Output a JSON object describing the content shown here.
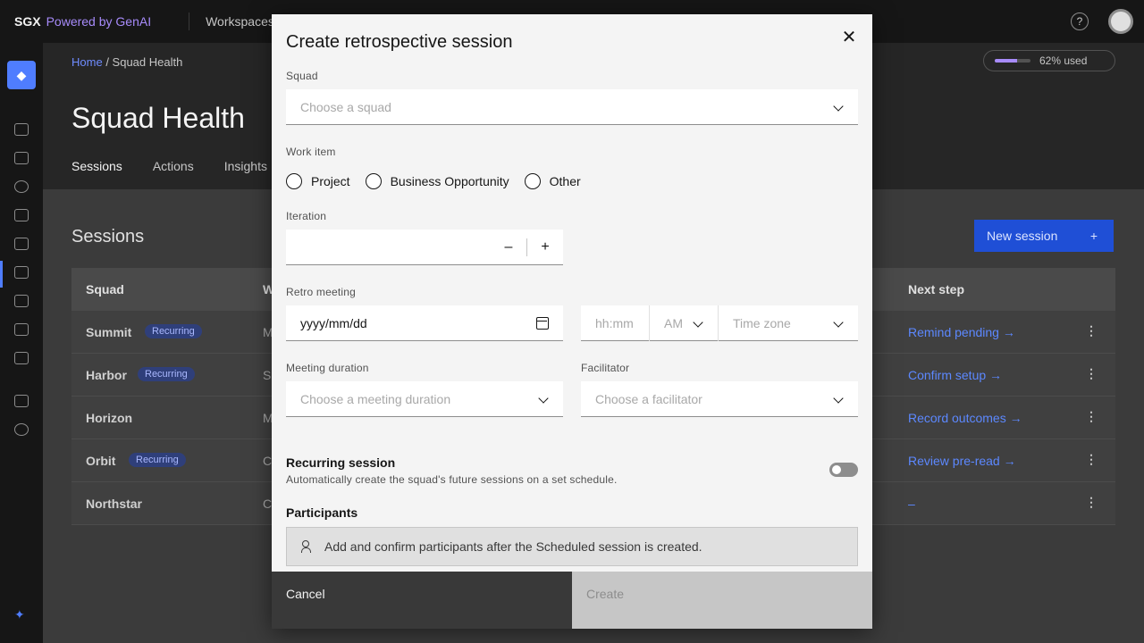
{
  "topbar": {
    "brand": "SGX",
    "brand_sub": "Powered by GenAI",
    "nav": "Workspaces"
  },
  "header": {
    "breadcrumb_home": "Home",
    "breadcrumb_current": "Squad Health",
    "usage_label": "62% used",
    "usage_fraction": 0.62,
    "title": "Squad Health",
    "tabs": [
      "Sessions",
      "Actions",
      "Insights"
    ]
  },
  "main": {
    "section_title": "Sessions",
    "new_button": "New session",
    "table": {
      "headers": [
        "Squad",
        "W",
        "Next step"
      ],
      "rows": [
        {
          "squad": "Summit",
          "tag": "Recurring",
          "mid": "M",
          "next": "Remind pending →"
        },
        {
          "squad": "Harbor",
          "tag": "Recurring",
          "mid": "S",
          "next": "Confirm setup →"
        },
        {
          "squad": "Horizon",
          "tag": "",
          "mid": "M",
          "next": "Record outcomes →"
        },
        {
          "squad": "Orbit",
          "tag": "Recurring",
          "mid": "C",
          "next": "Review pre-read →"
        },
        {
          "squad": "Northstar",
          "tag": "",
          "mid": "C",
          "next": "–"
        }
      ]
    }
  },
  "modal": {
    "title": "Create retrospective session",
    "squad": {
      "label": "Squad",
      "placeholder": "Choose a squad"
    },
    "work_item": {
      "label": "Work item",
      "options": [
        "Project",
        "Business Opportunity",
        "Other"
      ]
    },
    "iteration": {
      "label": "Iteration",
      "value": "",
      "decrement": "–",
      "increment": "+"
    },
    "retro_meeting": {
      "label": "Retro meeting",
      "date_placeholder": "yyyy/mm/dd",
      "time_placeholder": "hh:mm",
      "ampm": "AM",
      "timezone_placeholder": "Time zone"
    },
    "duration": {
      "label": "Meeting duration",
      "placeholder": "Choose a meeting duration"
    },
    "facilitator": {
      "label": "Facilitator",
      "placeholder": "Choose a facilitator"
    },
    "recurring": {
      "title": "Recurring session",
      "description": "Automatically create the squad's future sessions on a set schedule.",
      "enabled": false
    },
    "participants": {
      "title": "Participants",
      "note": "Add and confirm participants after the Scheduled session is created."
    },
    "buttons": {
      "cancel": "Cancel",
      "create": "Create"
    }
  }
}
